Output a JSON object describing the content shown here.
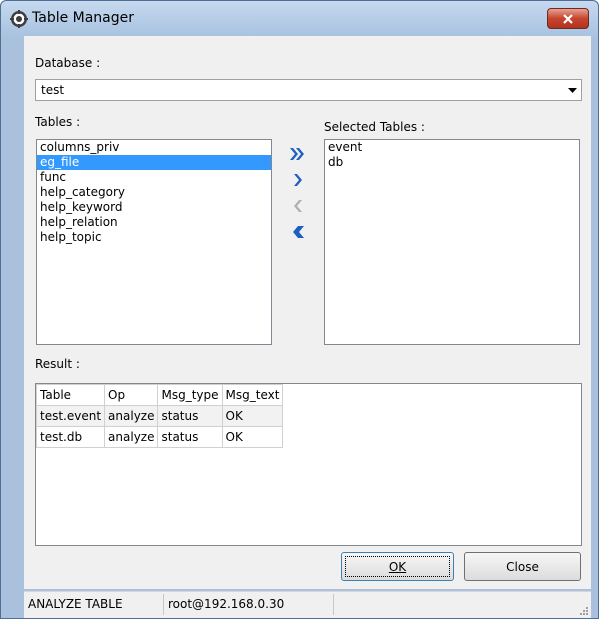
{
  "window": {
    "title": "Table Manager"
  },
  "database": {
    "label": "Database :",
    "selected": "test"
  },
  "tables": {
    "label": "Tables :",
    "items": [
      "columns_priv",
      "eg_file",
      "func",
      "help_category",
      "help_keyword",
      "help_relation",
      "help_topic"
    ],
    "selected_index": 1
  },
  "selected_tables": {
    "label": "Selected Tables :",
    "items": [
      "event",
      "db"
    ]
  },
  "movers": {
    "add_all_icon": "double-chevron-right-icon",
    "add_icon": "chevron-right-icon",
    "remove_icon": "chevron-left-icon",
    "remove_all_icon": "double-chevron-left-icon"
  },
  "result": {
    "label": "Result :",
    "columns": [
      "Table",
      "Op",
      "Msg_type",
      "Msg_text"
    ],
    "rows": [
      [
        "test.event",
        "analyze",
        "status",
        "OK"
      ],
      [
        "test.db",
        "analyze",
        "status",
        "OK"
      ]
    ]
  },
  "buttons": {
    "ok": "OK",
    "close": "Close"
  },
  "status": {
    "command": "ANALYZE TABLE",
    "connection": "root@192.168.0.30"
  },
  "colors": {
    "selection": "#3399ff",
    "mover_active": "#1f5fbf",
    "mover_disabled": "#b0b0b0",
    "close_button": "#c7442e"
  }
}
